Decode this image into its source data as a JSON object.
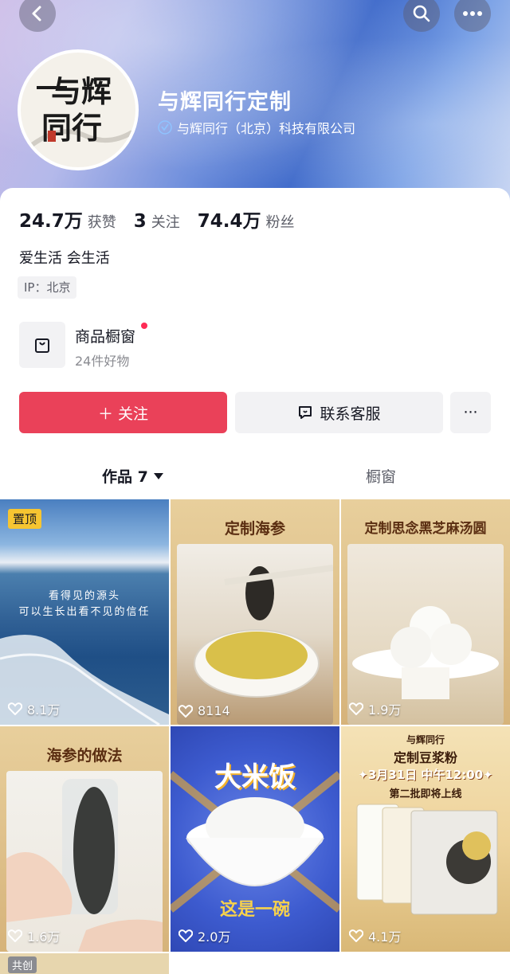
{
  "nav": {
    "back_icon": "chevron-left-icon",
    "search_icon": "search-icon",
    "more_icon": "more-horizontal-icon"
  },
  "profile": {
    "avatar_logo_line1": "与辉",
    "avatar_logo_line2": "同行",
    "name": "与辉同行定制",
    "verified_org": "与辉同行（北京）科技有限公司",
    "likes_value": "24.7万",
    "likes_label": "获赞",
    "following_value": "3",
    "following_label": "关注",
    "followers_value": "74.4万",
    "followers_label": "粉丝",
    "bio": "爱生活 会生活",
    "ip": "IP：北京"
  },
  "shop": {
    "title": "商品橱窗",
    "subtitle": "24件好物"
  },
  "actions": {
    "follow": "＋ 关注",
    "contact": "联系客服",
    "more": "···"
  },
  "tabs": {
    "works": "作品 7",
    "window": "橱窗"
  },
  "videos": [
    {
      "pinned_label": "置顶",
      "caption_line1": "看得见的源头",
      "caption_line2": "可以生长出看不见的信任",
      "likes": "8.1万"
    },
    {
      "title": "定制海参",
      "likes": "8114"
    },
    {
      "title": "定制思念黑芝麻汤圆",
      "likes": "1.9万"
    },
    {
      "title": "海参的做法",
      "likes": "1.6万"
    },
    {
      "title": "大米饭",
      "subtitle": "这是一碗",
      "likes": "2.0万"
    },
    {
      "brand": "与辉同行",
      "title": "定制豆浆粉",
      "date_line": "✦3月31日 中午12:00✦",
      "sub_line": "第二批即将上线",
      "likes": "4.1万"
    }
  ],
  "partial_tag": "共创",
  "colors": {
    "accent": "#ea4159",
    "pin": "#f6c531",
    "gold": "#d6b37a"
  }
}
